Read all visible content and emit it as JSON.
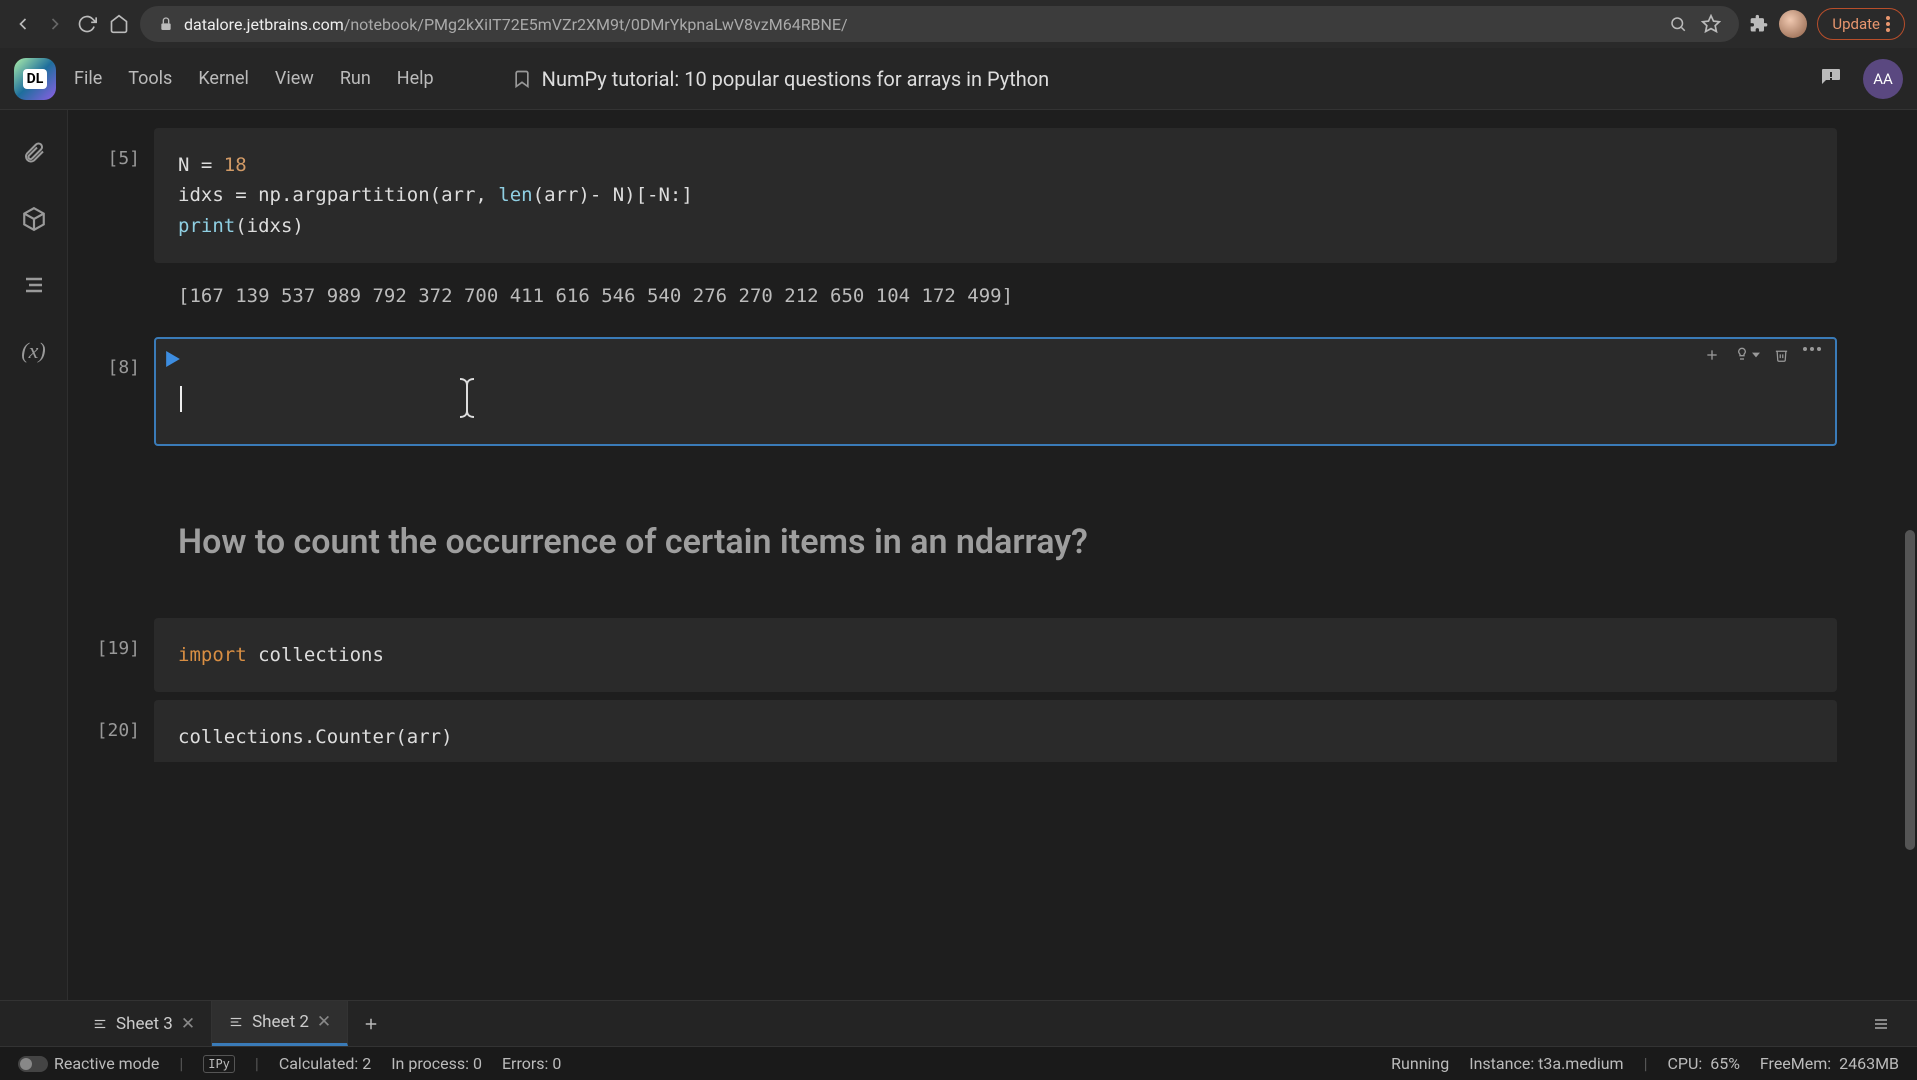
{
  "browser": {
    "url_domain": "datalore.jetbrains.com",
    "url_path": "/notebook/PMg2kXiIT72E5mVZr2XM9t/0DMrYkpnaLwV8vzM64RBNE/",
    "update_label": "Update"
  },
  "app": {
    "logo_text": "DL",
    "menu": [
      "File",
      "Tools",
      "Kernel",
      "View",
      "Run",
      "Help"
    ],
    "notebook_title": "NumPy tutorial: 10 popular questions for arrays in Python",
    "user_initials": "AA"
  },
  "cells": {
    "c5": {
      "prompt": "[5]",
      "line1_var": "N ",
      "line1_eq": "= ",
      "line1_val": "18",
      "line2": "idxs = np.argpartition(arr, ",
      "line2_len": "len",
      "line2_rest": "(arr)- N)[-N:]",
      "line3_print": "print",
      "line3_rest": "(idxs)",
      "output": "[167 139 537 989 792 372 700 411 616 546 540 276 270 212 650 104 172 499]"
    },
    "c8": {
      "prompt": "[8]",
      "content": ""
    },
    "md1": {
      "heading": "How to count the occurrence of certain items in an ndarray?"
    },
    "c19": {
      "prompt": "[19]",
      "kw": "import",
      "rest": " collections"
    },
    "c20": {
      "prompt": "[20]",
      "code": "collections.Counter(arr)"
    }
  },
  "sheets": {
    "tab1": "Sheet 3",
    "tab2": "Sheet 2"
  },
  "status": {
    "reactive": "Reactive mode",
    "ipy": "IPy",
    "calculated": "Calculated: 2",
    "inprocess": "In process: 0",
    "errors": "Errors: 0",
    "running": "Running",
    "instance": "Instance: t3a.medium",
    "cpu": "CPU:",
    "cpu_val": "65%",
    "freemem": "FreeMem:",
    "freemem_val": "2463MB"
  }
}
